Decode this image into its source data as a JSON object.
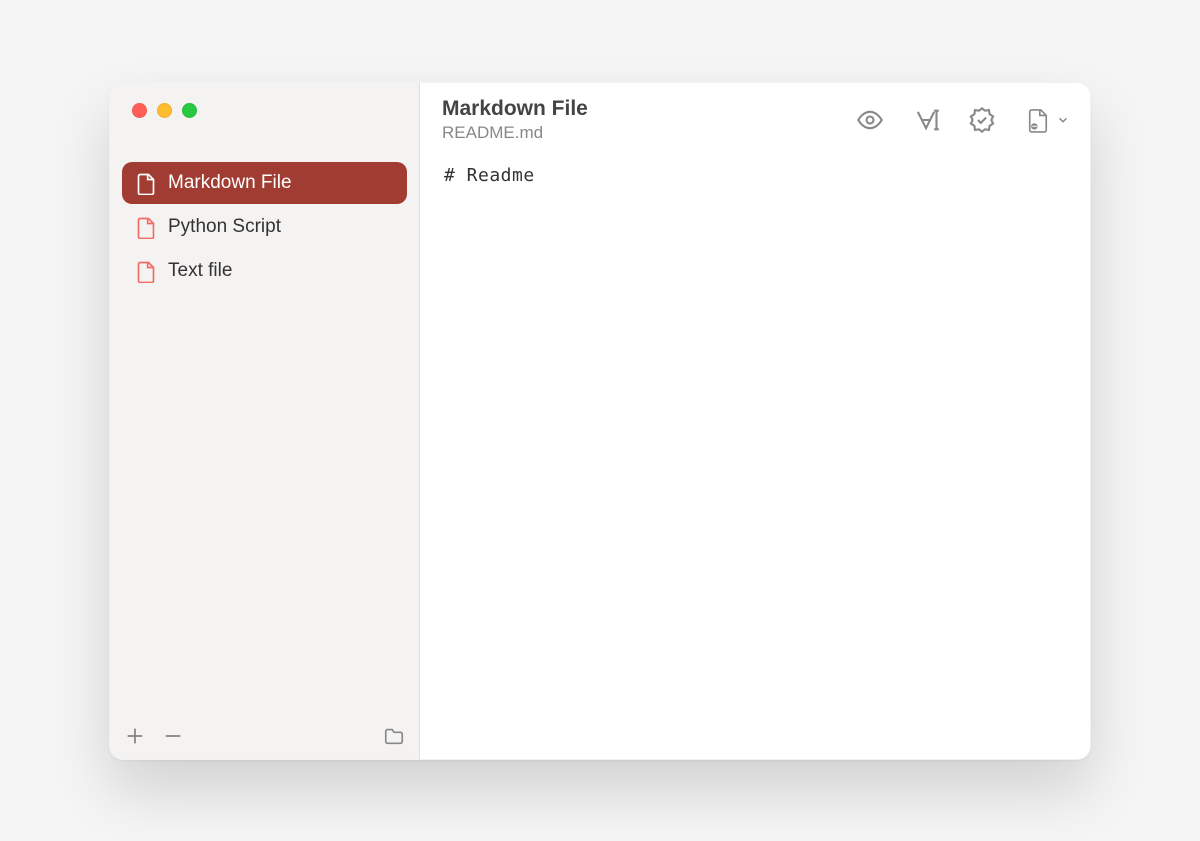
{
  "sidebar": {
    "files": [
      {
        "label": "Markdown File",
        "selected": true
      },
      {
        "label": "Python Script",
        "selected": false
      },
      {
        "label": "Text file",
        "selected": false
      }
    ]
  },
  "header": {
    "title": "Markdown File",
    "subtitle": "README.md"
  },
  "editor": {
    "content": "# Readme"
  },
  "colors": {
    "accent": "#a13c32",
    "file_icon": "#f36b63"
  }
}
